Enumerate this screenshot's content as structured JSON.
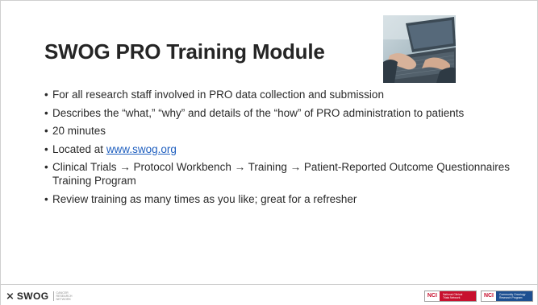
{
  "slide": {
    "title": "SWOG PRO Training Module",
    "bullets": [
      "For all research staff involved in PRO data collection and submission",
      "Describes the “what,” “why” and details of the “how” of PRO administration to patients",
      "20 minutes",
      "Clinical Trials → Protocol Workbench → Training → Patient-Reported Outcome Questionnaires Training Program",
      "Review training as many times as you like; great for a refresher"
    ],
    "located_prefix": "Located at ",
    "located_link": "www.swog.org"
  },
  "footer": {
    "swog_word": "SWOG",
    "swog_sub": [
      "CANCER",
      "RESEARCH",
      "NETWORK"
    ],
    "nci_logos": [
      {
        "mark": "NCI",
        "band_text": [
          "National Clinical",
          "Trials Network"
        ],
        "color": "#c8102e"
      },
      {
        "mark": "NCI",
        "band_text": [
          "Community Oncology",
          "Research Program"
        ],
        "color": "#1d4f91"
      }
    ]
  },
  "image": {
    "icon": "laptop-typing-photo"
  }
}
